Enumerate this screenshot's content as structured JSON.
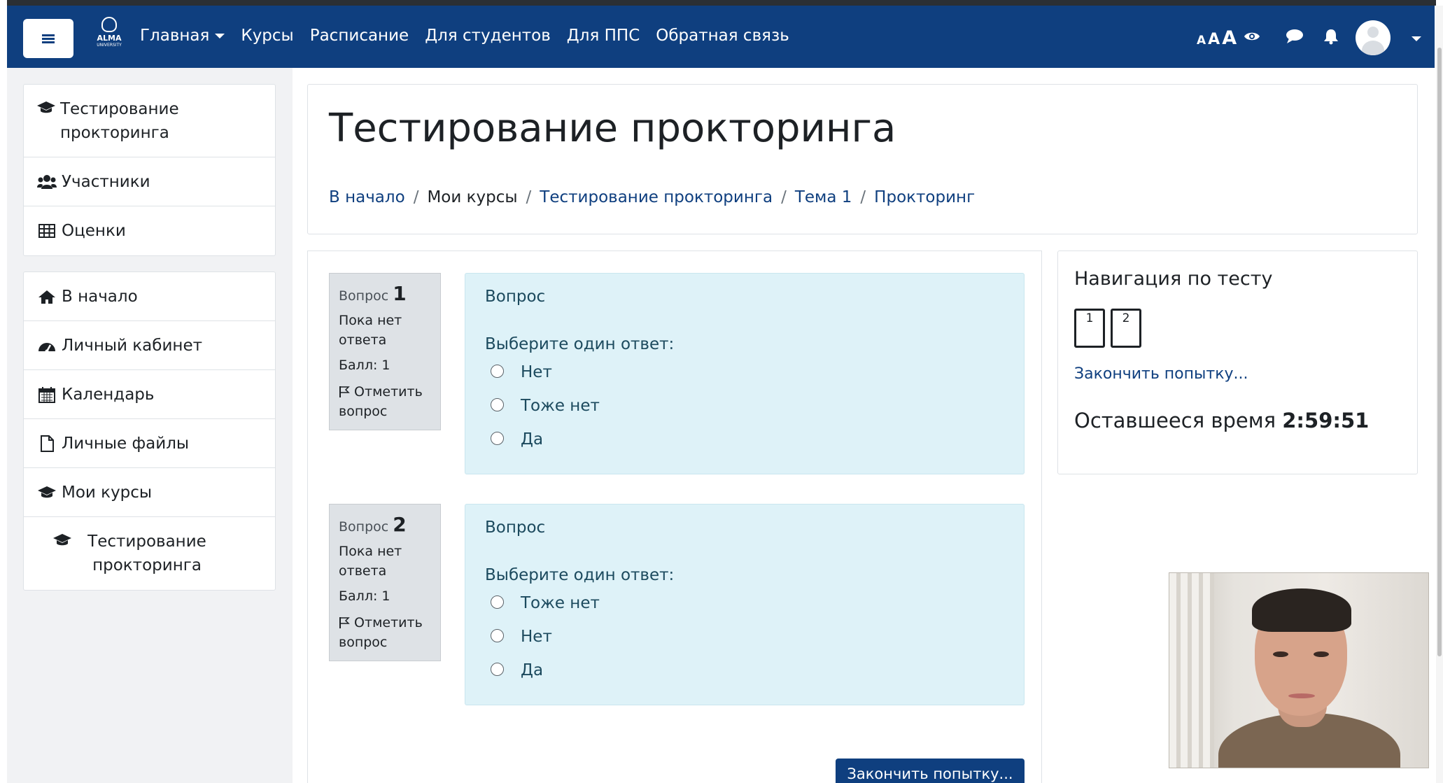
{
  "navbar": {
    "logo_text": "ALMA",
    "logo_subtext": "UNIVERSITY",
    "menu": [
      {
        "label": "Главная",
        "has_caret": true
      },
      {
        "label": "Курсы"
      },
      {
        "label": "Расписание"
      },
      {
        "label": "Для студентов"
      },
      {
        "label": "Для ППС"
      },
      {
        "label": "Обратная связь"
      }
    ],
    "font_size_controls": [
      "A",
      "A",
      "A"
    ]
  },
  "sidebar": {
    "course_block": [
      {
        "icon": "graduation-cap-icon",
        "label": "Тестирование прокторинга"
      },
      {
        "icon": "users-icon",
        "label": "Участники"
      },
      {
        "icon": "table-icon",
        "label": "Оценки"
      }
    ],
    "site_block": [
      {
        "icon": "home-icon",
        "label": "В начало"
      },
      {
        "icon": "dashboard-icon",
        "label": "Личный кабинет"
      },
      {
        "icon": "calendar-icon",
        "label": "Календарь"
      },
      {
        "icon": "file-icon",
        "label": "Личные файлы"
      },
      {
        "icon": "graduation-cap-icon",
        "label": "Мои курсы"
      },
      {
        "icon": "graduation-cap-icon",
        "label": "Тестирование прокторинга"
      }
    ]
  },
  "page": {
    "title": "Тестирование прокторинга",
    "breadcrumb": [
      "В начало",
      "Мои курсы",
      "Тестирование прокторинга",
      "Тема 1",
      "Прокторинг"
    ]
  },
  "questions": [
    {
      "label": "Вопрос",
      "number": "1",
      "status": "Пока нет ответа",
      "score": "Балл: 1",
      "flag": "Отметить вопрос",
      "text": "Вопрос",
      "prompt": "Выберите один ответ:",
      "options": [
        "Нет",
        "Тоже нет",
        "Да"
      ]
    },
    {
      "label": "Вопрос",
      "number": "2",
      "status": "Пока нет ответа",
      "score": "Балл: 1",
      "flag": "Отметить вопрос",
      "text": "Вопрос",
      "prompt": "Выберите один ответ:",
      "options": [
        "Тоже нет",
        "Нет",
        "Да"
      ]
    }
  ],
  "finish_button": "Закончить попытку...",
  "quiz_nav": {
    "title": "Навигация по тесту",
    "buttons": [
      "1",
      "2"
    ],
    "finish_link": "Закончить попытку...",
    "time_label": "Оставшееся время",
    "time_value": "2:59:51"
  },
  "colors": {
    "navbar": "#0f3f7f",
    "link": "#0f3f7f",
    "question_bg": "#def2f8",
    "question_info_bg": "#dee2e6"
  }
}
